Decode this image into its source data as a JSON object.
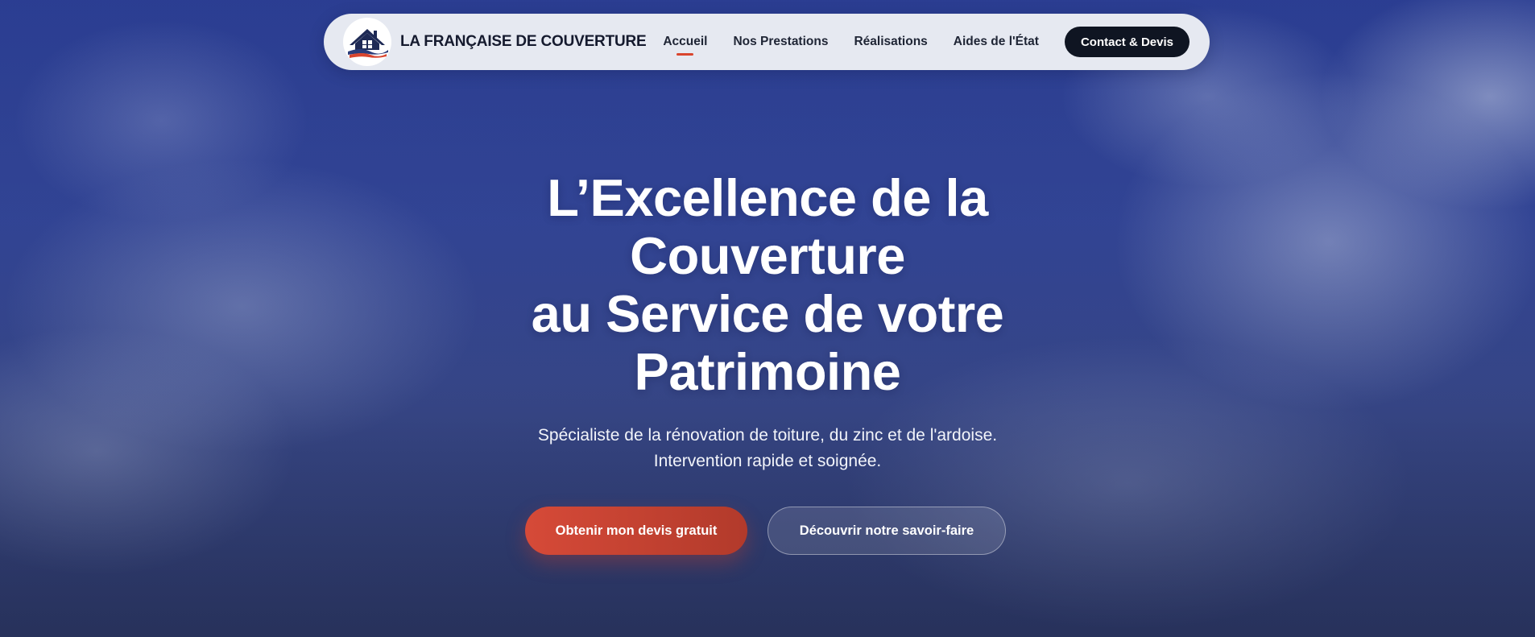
{
  "brand": {
    "name": "LA FRANÇAISE DE COUVERTURE",
    "logo_icon": "house-roof-logo-icon"
  },
  "nav": {
    "items": [
      {
        "label": "Accueil",
        "active": true
      },
      {
        "label": "Nos Prestations",
        "active": false
      },
      {
        "label": "Réalisations",
        "active": false
      },
      {
        "label": "Aides de l'État",
        "active": false
      }
    ],
    "cta_label": "Contact & Devis"
  },
  "hero": {
    "title_lines": [
      "L’Excellence de la",
      "Couverture",
      "au Service de votre",
      "Patrimoine"
    ],
    "subtitle_lines": [
      "Spécialiste de la rénovation de toiture, du zinc et de l'ardoise.",
      "Intervention rapide et soignée."
    ],
    "primary_button": "Obtenir mon devis gratuit",
    "secondary_button": "Découvrir notre savoir-faire"
  },
  "colors": {
    "accent_red": "#d64a38",
    "navy": "#0f1522",
    "sky_blue": "#2c3f95"
  }
}
